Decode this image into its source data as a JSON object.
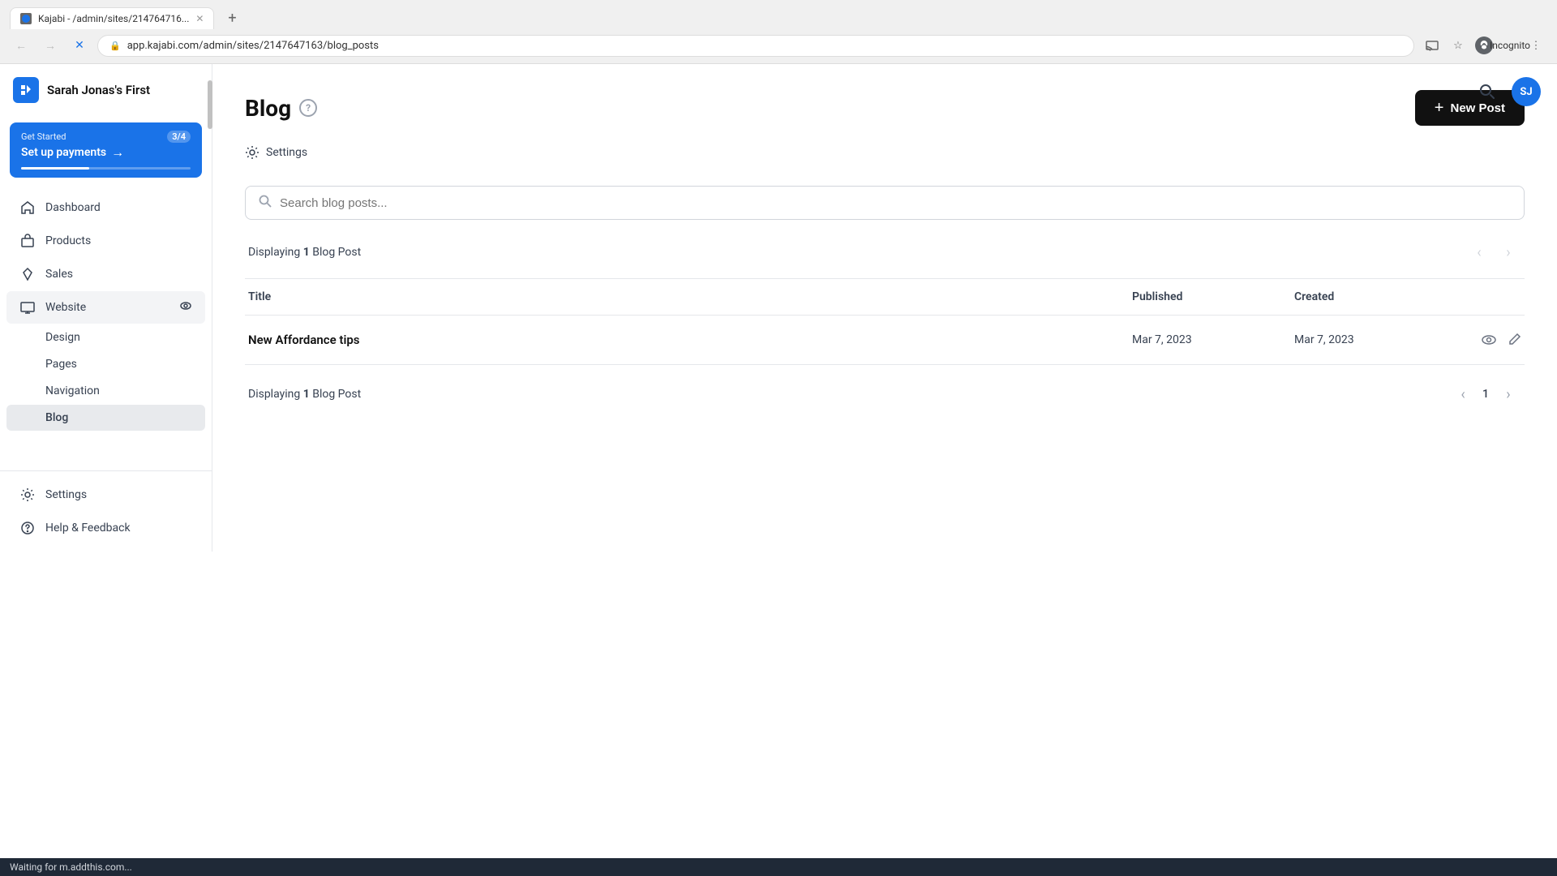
{
  "browser": {
    "tab_title": "Kajabi - /admin/sites/214764716...",
    "tab_favicon": "K",
    "url": "app.kajabi.com/admin/sites/2147647163/blog_posts",
    "incognito_label": "Incognito",
    "nav_back_disabled": false,
    "nav_forward_disabled": false,
    "loading": true
  },
  "sidebar": {
    "brand": "Sarah Jonas's First",
    "logo_letter": "K",
    "get_started": {
      "label": "Get Started",
      "count": "3/4",
      "action": "Set up payments",
      "progress_pct": 40
    },
    "nav_items": [
      {
        "id": "dashboard",
        "label": "Dashboard",
        "icon": "home"
      },
      {
        "id": "products",
        "label": "Products",
        "icon": "box"
      },
      {
        "id": "sales",
        "label": "Sales",
        "icon": "diamond"
      },
      {
        "id": "website",
        "label": "Website",
        "icon": "monitor",
        "has_eye": true,
        "expanded": true
      }
    ],
    "website_sub_items": [
      {
        "id": "design",
        "label": "Design"
      },
      {
        "id": "pages",
        "label": "Pages"
      },
      {
        "id": "navigation",
        "label": "Navigation"
      },
      {
        "id": "blog",
        "label": "Blog",
        "active": true
      }
    ],
    "bottom_items": [
      {
        "id": "settings",
        "label": "Settings",
        "icon": "gear"
      },
      {
        "id": "help",
        "label": "Help & Feedback",
        "icon": "question"
      }
    ]
  },
  "page": {
    "title": "Blog",
    "new_post_button": "+ New Post",
    "settings_label": "Settings",
    "search_placeholder": "Search blog posts...",
    "displaying_prefix": "Displaying",
    "displaying_count": "1",
    "displaying_suffix": "Blog Post",
    "table_columns": [
      "Title",
      "Published",
      "Created"
    ],
    "blog_posts": [
      {
        "id": 1,
        "title": "New Affordance tips",
        "published": "Mar 7, 2023",
        "created": "Mar 7, 2023"
      }
    ],
    "bottom_display_prefix": "Displaying",
    "bottom_display_count": "1",
    "bottom_display_suffix": "Blog Post",
    "current_page": "1"
  },
  "status_bar": {
    "text": "Waiting for m.addthis.com..."
  },
  "header": {
    "search_icon": "🔍",
    "avatar_initials": "SJ"
  }
}
